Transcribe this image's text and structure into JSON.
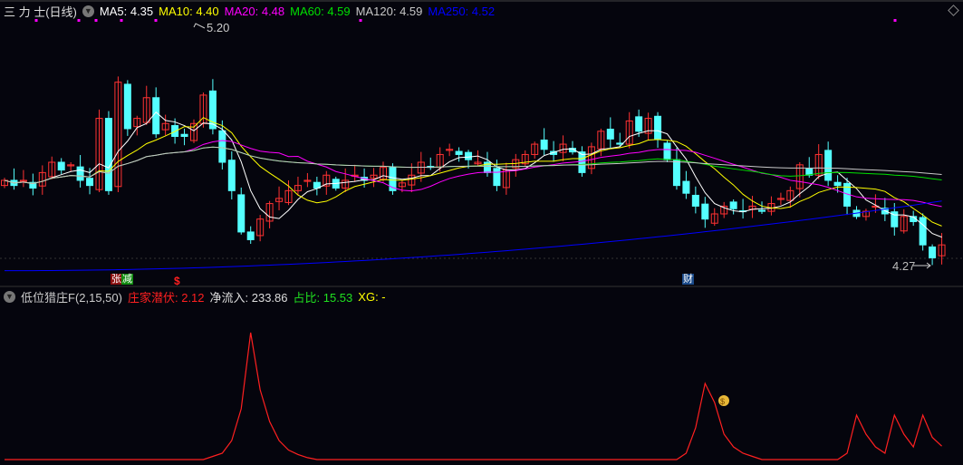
{
  "header": {
    "title": "三 力 士(日线)",
    "ma": [
      {
        "label": "MA5: 4.35",
        "color": "#ffffff"
      },
      {
        "label": "MA10: 4.40",
        "color": "#ffff00"
      },
      {
        "label": "MA20: 4.48",
        "color": "#ff00ff"
      },
      {
        "label": "MA60: 4.59",
        "color": "#00e000"
      },
      {
        "label": "MA120: 4.59",
        "color": "#c8c8c8"
      },
      {
        "label": "MA250: 4.52",
        "color": "#0000ff"
      }
    ]
  },
  "annotations": {
    "high": "5.20",
    "low": "4.27",
    "tag_zhang": "张",
    "tag_jian": "减",
    "tag_dollar": "$",
    "tag_cai": "财"
  },
  "indicator": {
    "name": "低位猎庄F(2,15,50)",
    "zjqf": "庄家潜伏: 2.12",
    "jlr": "净流入: 233.86",
    "zb": "占比: 15.53",
    "xg": "XG: -"
  },
  "colors": {
    "up": "#ff3232",
    "down": "#54ffff",
    "zjqf": "#ff2020"
  },
  "chart_data": {
    "type": "candlestick",
    "closes": [
      4.6,
      4.58,
      4.6,
      4.57,
      4.63,
      4.67,
      4.64,
      4.66,
      4.6,
      4.58,
      4.84,
      4.56,
      4.98,
      4.8,
      4.84,
      4.92,
      4.78,
      4.82,
      4.77,
      4.77,
      4.82,
      4.93,
      4.8,
      4.67,
      4.56,
      4.4,
      4.37,
      4.45,
      4.51,
      4.53,
      4.56,
      4.58,
      4.6,
      4.57,
      4.62,
      4.57,
      4.6,
      4.62,
      4.6,
      4.62,
      4.65,
      4.56,
      4.59,
      4.62,
      4.67,
      4.65,
      4.7,
      4.72,
      4.7,
      4.68,
      4.67,
      4.63,
      4.58,
      4.64,
      4.68,
      4.7,
      4.74,
      4.72,
      4.7,
      4.74,
      4.71,
      4.63,
      4.73,
      4.79,
      4.76,
      4.74,
      4.83,
      4.79,
      4.84,
      4.76,
      4.68,
      4.58,
      4.55,
      4.5,
      4.45,
      4.47,
      4.5,
      4.49,
      4.48,
      4.5,
      4.48,
      4.51,
      4.53,
      4.56,
      4.66,
      4.62,
      4.7,
      4.6,
      4.58,
      4.5,
      4.46,
      4.48,
      4.5,
      4.47,
      4.42,
      4.46,
      4.44,
      4.35,
      4.3,
      4.35
    ],
    "ma250_range": [
      4.25,
      4.52
    ],
    "price_range": [
      4.2,
      5.26
    ],
    "indicator_values": [
      0,
      0,
      0,
      0,
      0,
      0,
      0,
      0,
      0,
      0,
      0,
      0,
      0,
      0,
      0,
      0,
      0,
      0,
      0,
      0,
      0,
      0,
      0.5,
      1,
      3,
      8,
      20,
      11,
      6,
      3,
      1.5,
      0.8,
      0.3,
      0,
      0,
      0,
      0,
      0,
      0,
      0,
      0,
      0,
      0,
      0,
      0,
      0,
      0,
      0,
      0,
      0,
      0,
      0,
      0,
      0,
      0,
      0,
      0,
      0,
      0,
      0,
      0,
      0,
      0,
      0,
      0,
      0,
      0,
      0,
      0,
      0,
      0,
      0,
      1,
      5,
      12,
      9,
      4,
      2,
      1,
      0.5,
      0,
      0,
      0,
      0,
      0,
      0,
      0,
      0,
      0,
      1,
      7,
      4,
      2,
      1,
      7,
      4,
      2,
      7,
      3.5,
      2.12
    ]
  }
}
